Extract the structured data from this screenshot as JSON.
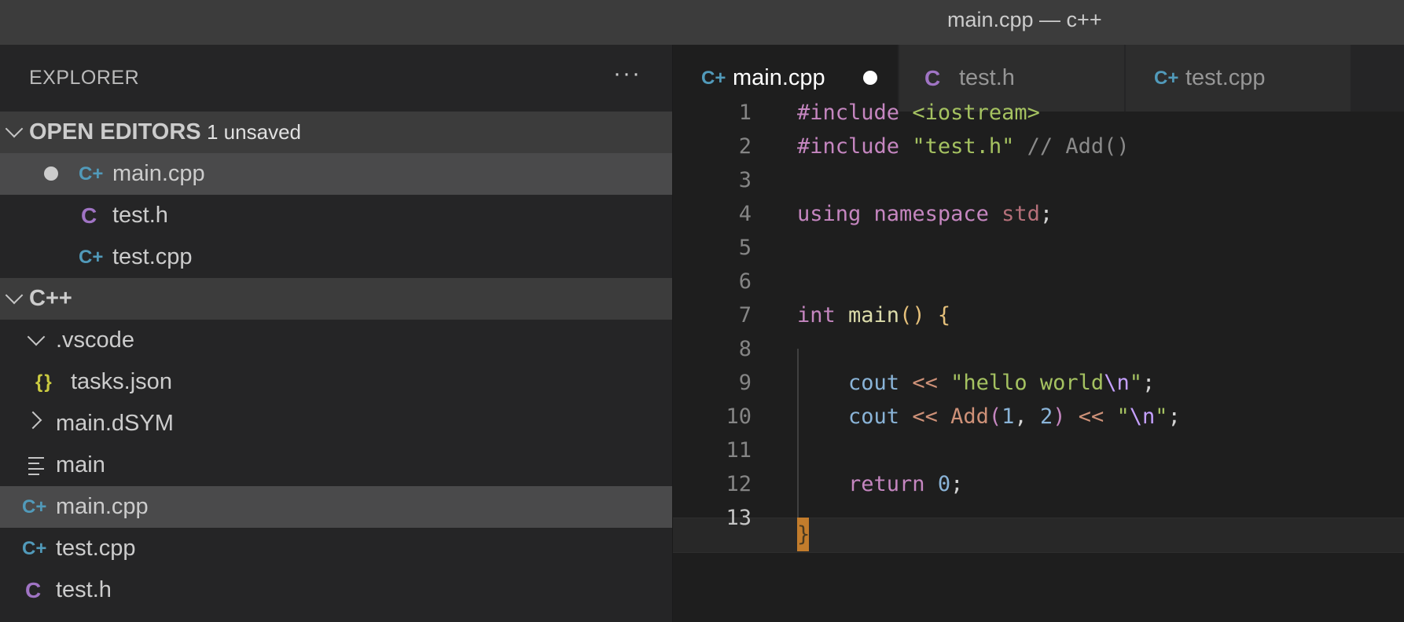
{
  "window": {
    "title": "main.cpp — c++"
  },
  "explorer": {
    "header_label": "EXPLORER",
    "more_label": "···",
    "open_editors": {
      "label": "OPEN EDITORS",
      "badge": "1 unsaved",
      "items": [
        {
          "name": "main.cpp",
          "icon": "cpp-icon",
          "unsaved": true
        },
        {
          "name": "test.h",
          "icon": "c-header-icon"
        },
        {
          "name": "test.cpp",
          "icon": "cpp-icon"
        }
      ]
    },
    "folder": {
      "label": "C++",
      "items": [
        {
          "name": ".vscode",
          "type": "folder-open"
        },
        {
          "name": "tasks.json",
          "type": "json",
          "icon_text": "{}"
        },
        {
          "name": "main.dSYM",
          "type": "folder-closed"
        },
        {
          "name": "main",
          "type": "binary"
        },
        {
          "name": "main.cpp",
          "type": "cpp",
          "selected": true
        },
        {
          "name": "test.cpp",
          "type": "cpp"
        },
        {
          "name": "test.h",
          "type": "header"
        }
      ]
    }
  },
  "icons": {
    "cpp": "C+",
    "header": "C"
  },
  "tabs": [
    {
      "label": "main.cpp",
      "active": true,
      "dirty": true
    },
    {
      "label": "test.h"
    },
    {
      "label": "test.cpp"
    }
  ],
  "editor": {
    "line_numbers": [
      "1",
      "2",
      "3",
      "4",
      "5",
      "6",
      "7",
      "8",
      "9",
      "10",
      "11",
      "12",
      "13"
    ],
    "lines": [
      [
        [
          "pp",
          "#include "
        ],
        [
          "s2",
          "<iostream>"
        ]
      ],
      [
        [
          "pp",
          "#include "
        ],
        [
          "s2",
          "\"test.h\""
        ],
        [
          "cm",
          " // Add()"
        ]
      ],
      [],
      [
        [
          "k",
          "using "
        ],
        [
          "k",
          "namespace "
        ],
        [
          "t",
          "std"
        ],
        [
          "op",
          ";"
        ]
      ],
      [],
      [],
      [
        [
          "k",
          "int "
        ],
        [
          "fn",
          "main"
        ],
        [
          "brk",
          "()"
        ],
        [
          "op",
          " "
        ],
        [
          "brk",
          "{"
        ]
      ],
      [],
      [
        [
          "op",
          "    "
        ],
        [
          "var",
          "cout"
        ],
        [
          "op",
          " "
        ],
        [
          "s",
          "<<"
        ],
        [
          "op",
          " "
        ],
        [
          "s2",
          "\"hello world"
        ],
        [
          "esc",
          "\\n"
        ],
        [
          "s2",
          "\""
        ],
        [
          "op",
          ";"
        ]
      ],
      [
        [
          "op",
          "    "
        ],
        [
          "var",
          "cout"
        ],
        [
          "op",
          " "
        ],
        [
          "s",
          "<<"
        ],
        [
          "op",
          " "
        ],
        [
          "s",
          "Add"
        ],
        [
          "brk2",
          "("
        ],
        [
          "var",
          "1"
        ],
        [
          "op",
          ", "
        ],
        [
          "var",
          "2"
        ],
        [
          "brk2",
          ")"
        ],
        [
          "op",
          " "
        ],
        [
          "s",
          "<<"
        ],
        [
          "op",
          " "
        ],
        [
          "s2",
          "\""
        ],
        [
          "esc",
          "\\n"
        ],
        [
          "s2",
          "\""
        ],
        [
          "op",
          ";"
        ]
      ],
      [],
      [
        [
          "op",
          "    "
        ],
        [
          "k",
          "return "
        ],
        [
          "var",
          "0"
        ],
        [
          "op",
          ";"
        ]
      ],
      []
    ],
    "cursor_char": "}",
    "colors": {
      "accent": "#c27c2c",
      "background": "#1e1e1e"
    }
  }
}
